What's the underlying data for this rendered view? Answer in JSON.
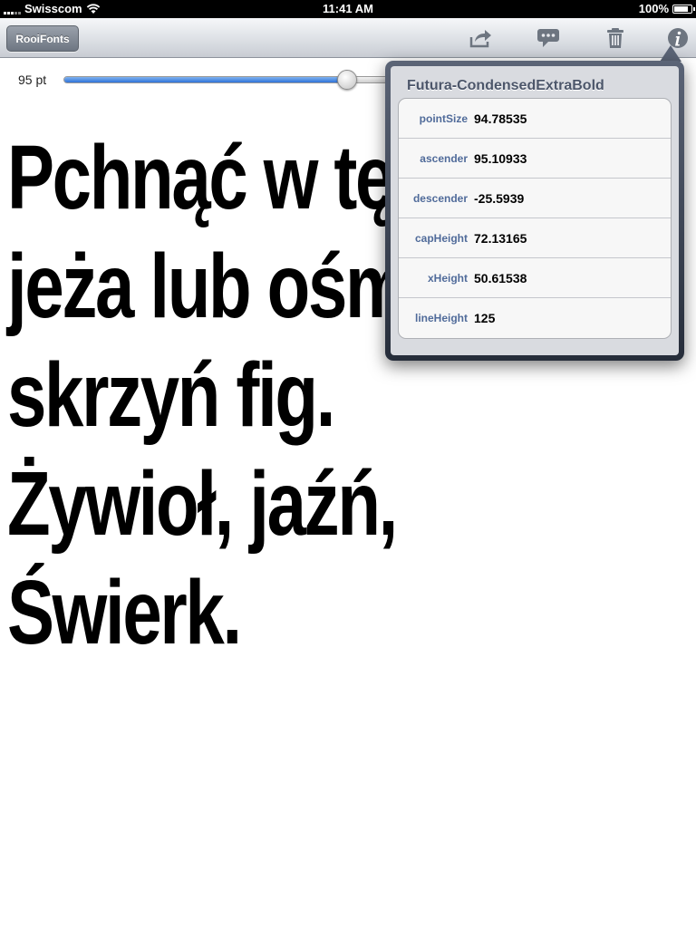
{
  "status_bar": {
    "carrier": "Swisscom",
    "time": "11:41 AM",
    "battery_percent": "100%",
    "battery_level": 1.0
  },
  "toolbar": {
    "back_label": "RooiFonts",
    "icons": [
      "share-icon",
      "comment-icon",
      "trash-icon",
      "info-icon"
    ]
  },
  "font_size": {
    "label": "95 pt",
    "slider_value": 0.87
  },
  "sample_text": {
    "lines": [
      "Pchnąć w tę łódź",
      "jeża lub ośm",
      "skrzyń fig.",
      "Żywioł, jaźń,",
      "Świerk."
    ]
  },
  "popover": {
    "title": "Futura-CondensedExtraBold",
    "metrics": [
      {
        "key": "pointSize",
        "value": "94.78535"
      },
      {
        "key": "ascender",
        "value": "95.10933"
      },
      {
        "key": "descender",
        "value": "-25.5939"
      },
      {
        "key": "capHeight",
        "value": "72.13165"
      },
      {
        "key": "xHeight",
        "value": "50.61538"
      },
      {
        "key": "lineHeight",
        "value": "125"
      }
    ]
  },
  "colors": {
    "slider_fill": "#2f73d9",
    "metric_key": "#506b9a"
  }
}
